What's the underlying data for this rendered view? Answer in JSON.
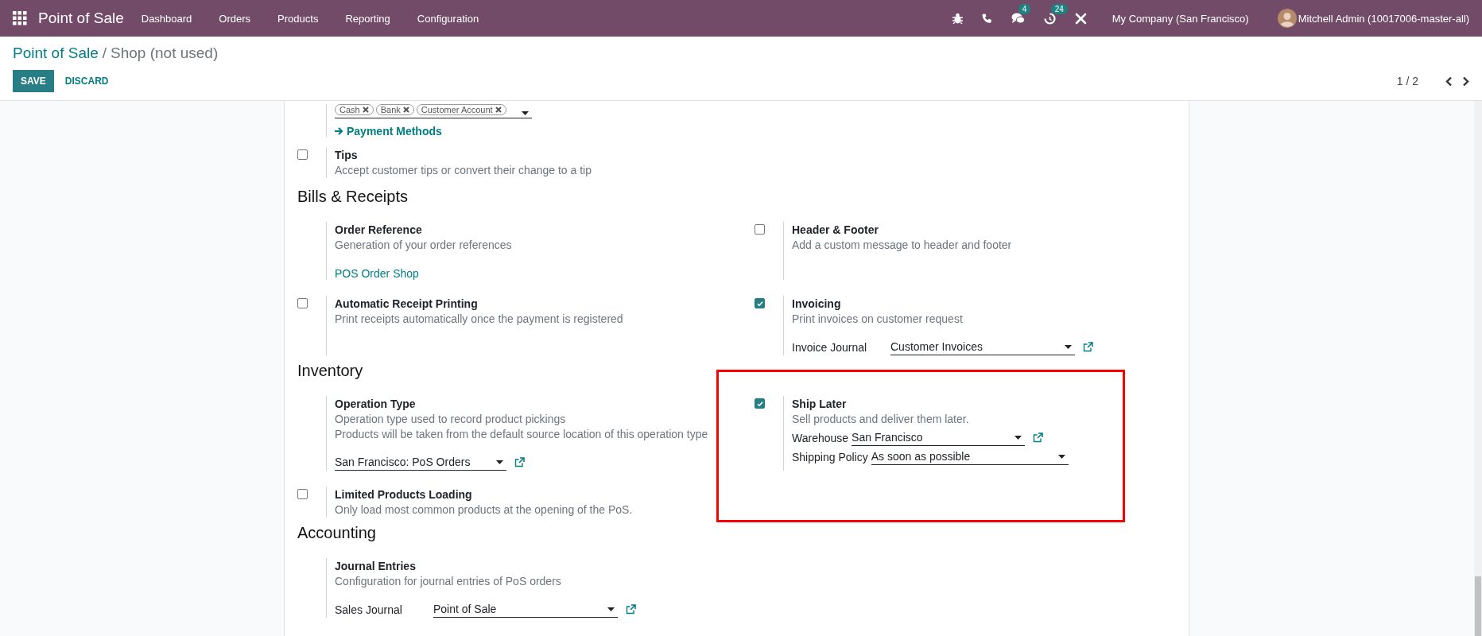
{
  "navbar": {
    "app_title": "Point of Sale",
    "menu": [
      "Dashboard",
      "Orders",
      "Products",
      "Reporting",
      "Configuration"
    ],
    "systray": [
      {
        "kind": "bug"
      },
      {
        "kind": "phone"
      },
      {
        "kind": "chat",
        "badge": "4"
      },
      {
        "kind": "activity",
        "badge": "24"
      },
      {
        "kind": "tools"
      }
    ],
    "company": "My Company (San Francisco)",
    "user": "Mitchell Admin (10017006-master-all)"
  },
  "breadcrumb": {
    "parent": "Point of Sale",
    "separator": "/",
    "current": "Shop (not used)"
  },
  "buttons": [
    {
      "label": "SAVE",
      "kind": "primary"
    },
    {
      "label": "DISCARD",
      "kind": "link"
    }
  ],
  "pager": "1 / 2",
  "sections": [
    {
      "settings": [
        {
          "tags": [
            "Cash",
            "Bank",
            "Customer Account"
          ],
          "link": {
            "text": "Payment Methods",
            "kind": "arrow"
          }
        }
      ]
    },
    {
      "settings": [
        {
          "checked": false,
          "title": "Tips",
          "descriptions": [
            "Accept customer tips or convert their change to a tip"
          ]
        }
      ]
    },
    {
      "title": "Bills & Receipts",
      "settings": [
        {
          "title": "Order Reference",
          "descriptions": [
            "Generation of your order references"
          ],
          "link": {
            "text": "POS Order Shop",
            "kind": "plain"
          }
        },
        {
          "checked": false,
          "title": "Header & Footer",
          "descriptions": [
            "Add a custom message to header and footer"
          ]
        },
        {
          "checked": false,
          "title": "Automatic Receipt Printing",
          "descriptions": [
            "Print receipts automatically once the payment is registered"
          ]
        },
        {
          "checked": true,
          "title": "Invoicing",
          "descriptions": [
            "Print invoices on customer request"
          ],
          "fields": [
            {
              "kind": "column",
              "label": "Invoice Journal",
              "value": "Customer Invoices",
              "open_link": true
            }
          ]
        }
      ]
    },
    {
      "title": "Inventory",
      "settings": [
        {
          "title": "Operation Type",
          "descriptions": [
            "Operation type used to record product pickings",
            "Products will be taken from the default source location of this operation type"
          ],
          "fields": [
            {
              "kind": "bare",
              "value": "San Francisco: PoS Orders",
              "open_link": true
            }
          ]
        },
        {
          "checked": true,
          "highlighted": true,
          "title": "Ship Later",
          "descriptions": [
            "Sell products and deliver them later."
          ],
          "fields": [
            {
              "kind": "inline",
              "label": "Warehouse",
              "value": "San Francisco",
              "open_link": true
            },
            {
              "kind": "inline",
              "label": "Shipping Policy",
              "value": "As soon as possible",
              "open_link": false
            }
          ]
        },
        {
          "checked": false,
          "title": "Limited Products Loading",
          "descriptions": [
            "Only load most common products at the opening of the PoS."
          ]
        }
      ]
    },
    {
      "title": "Accounting",
      "settings": [
        {
          "title": "Journal Entries",
          "descriptions": [
            "Configuration for journal entries of PoS orders"
          ],
          "fields": [
            {
              "kind": "column",
              "label": "Sales Journal",
              "value": "Point of Sale",
              "open_link": true
            }
          ]
        }
      ]
    }
  ]
}
